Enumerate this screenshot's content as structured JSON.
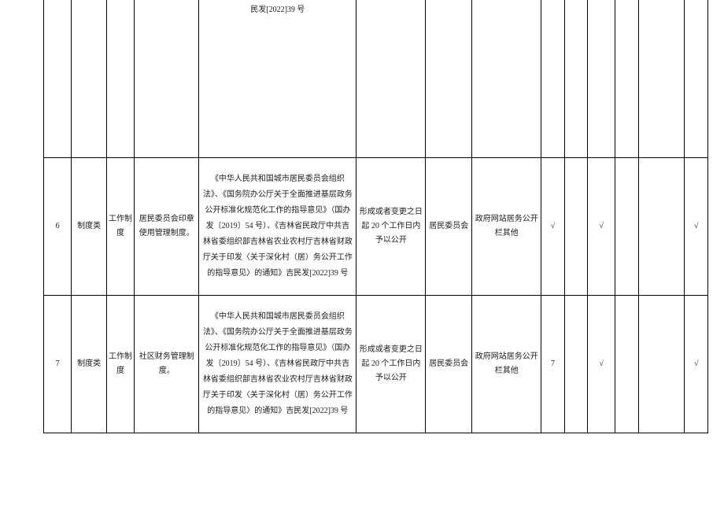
{
  "rows": [
    {
      "idx": "",
      "cat": "",
      "sub": "",
      "name": "",
      "basis_frag": "民发[2022]39 号",
      "time": "",
      "subj": "",
      "ch": "",
      "m0": "",
      "m1": "",
      "m2": "",
      "m3": "",
      "m4": "",
      "m5": ""
    },
    {
      "idx": "6",
      "cat": "制度类",
      "sub": "工作制度",
      "name": "居民委员会印章使用管理制度。",
      "basis": "《中华人民共和国城市居民委员会组织法》、《国务院办公厅关于全面推进基层政务公开标准化规范化工作的指导意见》（国办发〔2019〕54 号）、《吉林省民政厅中共吉林省委组织部吉林省农业农村厅吉林省财政厅关于印发〈关于深化村（居）务公开工作的指导意见〉的通知》吉民发[2022]39 号",
      "time": "形成或者变更之日起 20 个工作日内予以公开",
      "subj": "居民委员会",
      "ch": "政府网站居务公开栏其他",
      "m0": "√",
      "m1": "",
      "m2": "√",
      "m3": "",
      "m4": "",
      "m5": "√"
    },
    {
      "idx": "7",
      "cat": "制度类",
      "sub": "工作制度",
      "name": "社区财务管理制度。",
      "basis": "《中华人民共和国城市居民委员会组织法》、《国务院办公厅关于全面推进基层政务公开标准化规范化工作的指导意见》（国办发〔2019〕54 号）、《吉林省民政厅中共吉林省委组织部吉林省农业农村厅吉林省财政厅关于印发〈关于深化村（居）务公开工作的指导意见〉的通知》吉民发[2022]39 号",
      "time": "形成或者变更之日起 20 个工作日内予以公开",
      "subj": "居民委员会",
      "ch": "政府网站居务公开栏其他",
      "m0": "7",
      "m1": "",
      "m2": "√",
      "m3": "",
      "m4": "",
      "m5": "√"
    }
  ]
}
